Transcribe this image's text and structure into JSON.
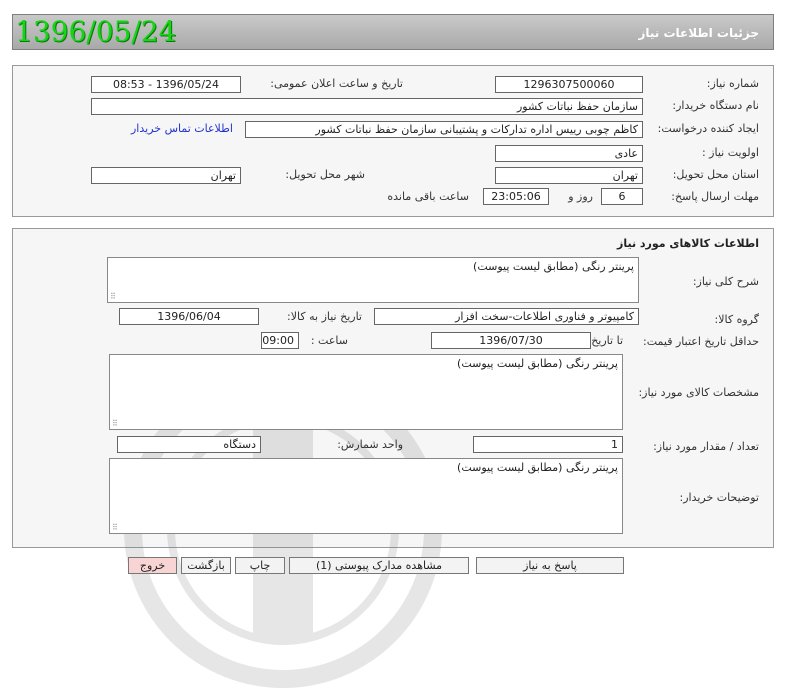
{
  "header": {
    "date": "1396/05/24",
    "title": "جزئیات اطلاعات نیاز"
  },
  "info": {
    "need_number_label": "شماره نیاز:",
    "need_number": "1296307500060",
    "announce_label": "تاریخ و ساعت اعلان عمومی:",
    "announce_value": "1396/05/24 - 08:53",
    "buyer_org_label": "نام دستگاه خریدار:",
    "buyer_org": "سازمان حفظ نباتات کشور",
    "requester_label": "ایجاد کننده درخواست:",
    "requester": "کاظم چوبی رییس اداره تدارکات و پشتیبانی سازمان حفظ نباتات کشور",
    "contact_link": "اطلاعات تماس خریدار",
    "priority_label": "اولویت نیاز :",
    "priority": "عادی",
    "province_label": "استان محل تحویل:",
    "province": "تهران",
    "city_label": "شهر محل تحویل:",
    "city": "تهران",
    "deadline_label": "مهلت ارسال پاسخ:",
    "days": "6",
    "days_label": "روز و",
    "time_left": "23:05:06",
    "time_left_label": "ساعت باقی مانده"
  },
  "goods": {
    "section_title": "اطلاعات کالاهای مورد نیاز",
    "summary_label": "شرح کلی نیاز:",
    "summary": "پرینتر رنگی (مطابق لیست پیوست)",
    "group_label": "گروه کالا:",
    "group": "کامپیوتر و فناوری اطلاعات-سخت افزار",
    "need_date_label": "تاریخ نیاز به کالا:",
    "need_date": "1396/06/04",
    "min_price_label": "حداقل تاریخ اعتبار قیمت:",
    "until_label": "تا تاریخ :",
    "until_date": "1396/07/30",
    "time_label": "ساعت :",
    "time": "09:00",
    "specs_label": "مشخصات کالای مورد نیاز:",
    "specs": "پرینتر رنگی (مطابق لیست پیوست)",
    "qty_label": "تعداد / مقدار مورد نیاز:",
    "qty": "1",
    "unit_label": "واحد شمارش:",
    "unit": "دستگاه",
    "buyer_notes_label": "توضیحات خریدار:",
    "buyer_notes": "پرینتر رنگی (مطابق لیست پیوست)"
  },
  "buttons": {
    "reply": "پاسخ به نیاز",
    "view_docs": "مشاهده مدارک پیوستی (1)",
    "print": "چاپ",
    "back": "بازگشت",
    "exit": "خروج"
  },
  "colors": {
    "date_green": "#18d418",
    "exit_bg": "#f8d4d4",
    "link_blue": "#1f33d0"
  }
}
